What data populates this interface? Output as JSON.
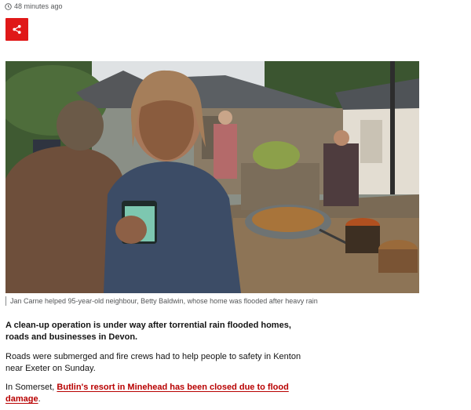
{
  "article": {
    "timestamp": "48 minutes ago",
    "share_icon": "share-icon",
    "image": {
      "caption": "Jan Carne helped 95-year-old neighbour, Betty Baldwin, whose home was flooded after heavy rain"
    },
    "lead": "A clean-up operation is under way after torrential rain flooded homes, roads and businesses in Devon.",
    "paragraph_2": "Roads were submerged and fire crews had to help people to safety in Kenton near Exeter on Sunday.",
    "paragraph_3": {
      "prefix": "In Somerset, ",
      "link_text": "Butlin's resort in Minehead has been closed due to flood damage",
      "suffix": "."
    }
  },
  "colors": {
    "accent": "#e01818",
    "link": "#b80000",
    "meta_text": "#545658"
  }
}
